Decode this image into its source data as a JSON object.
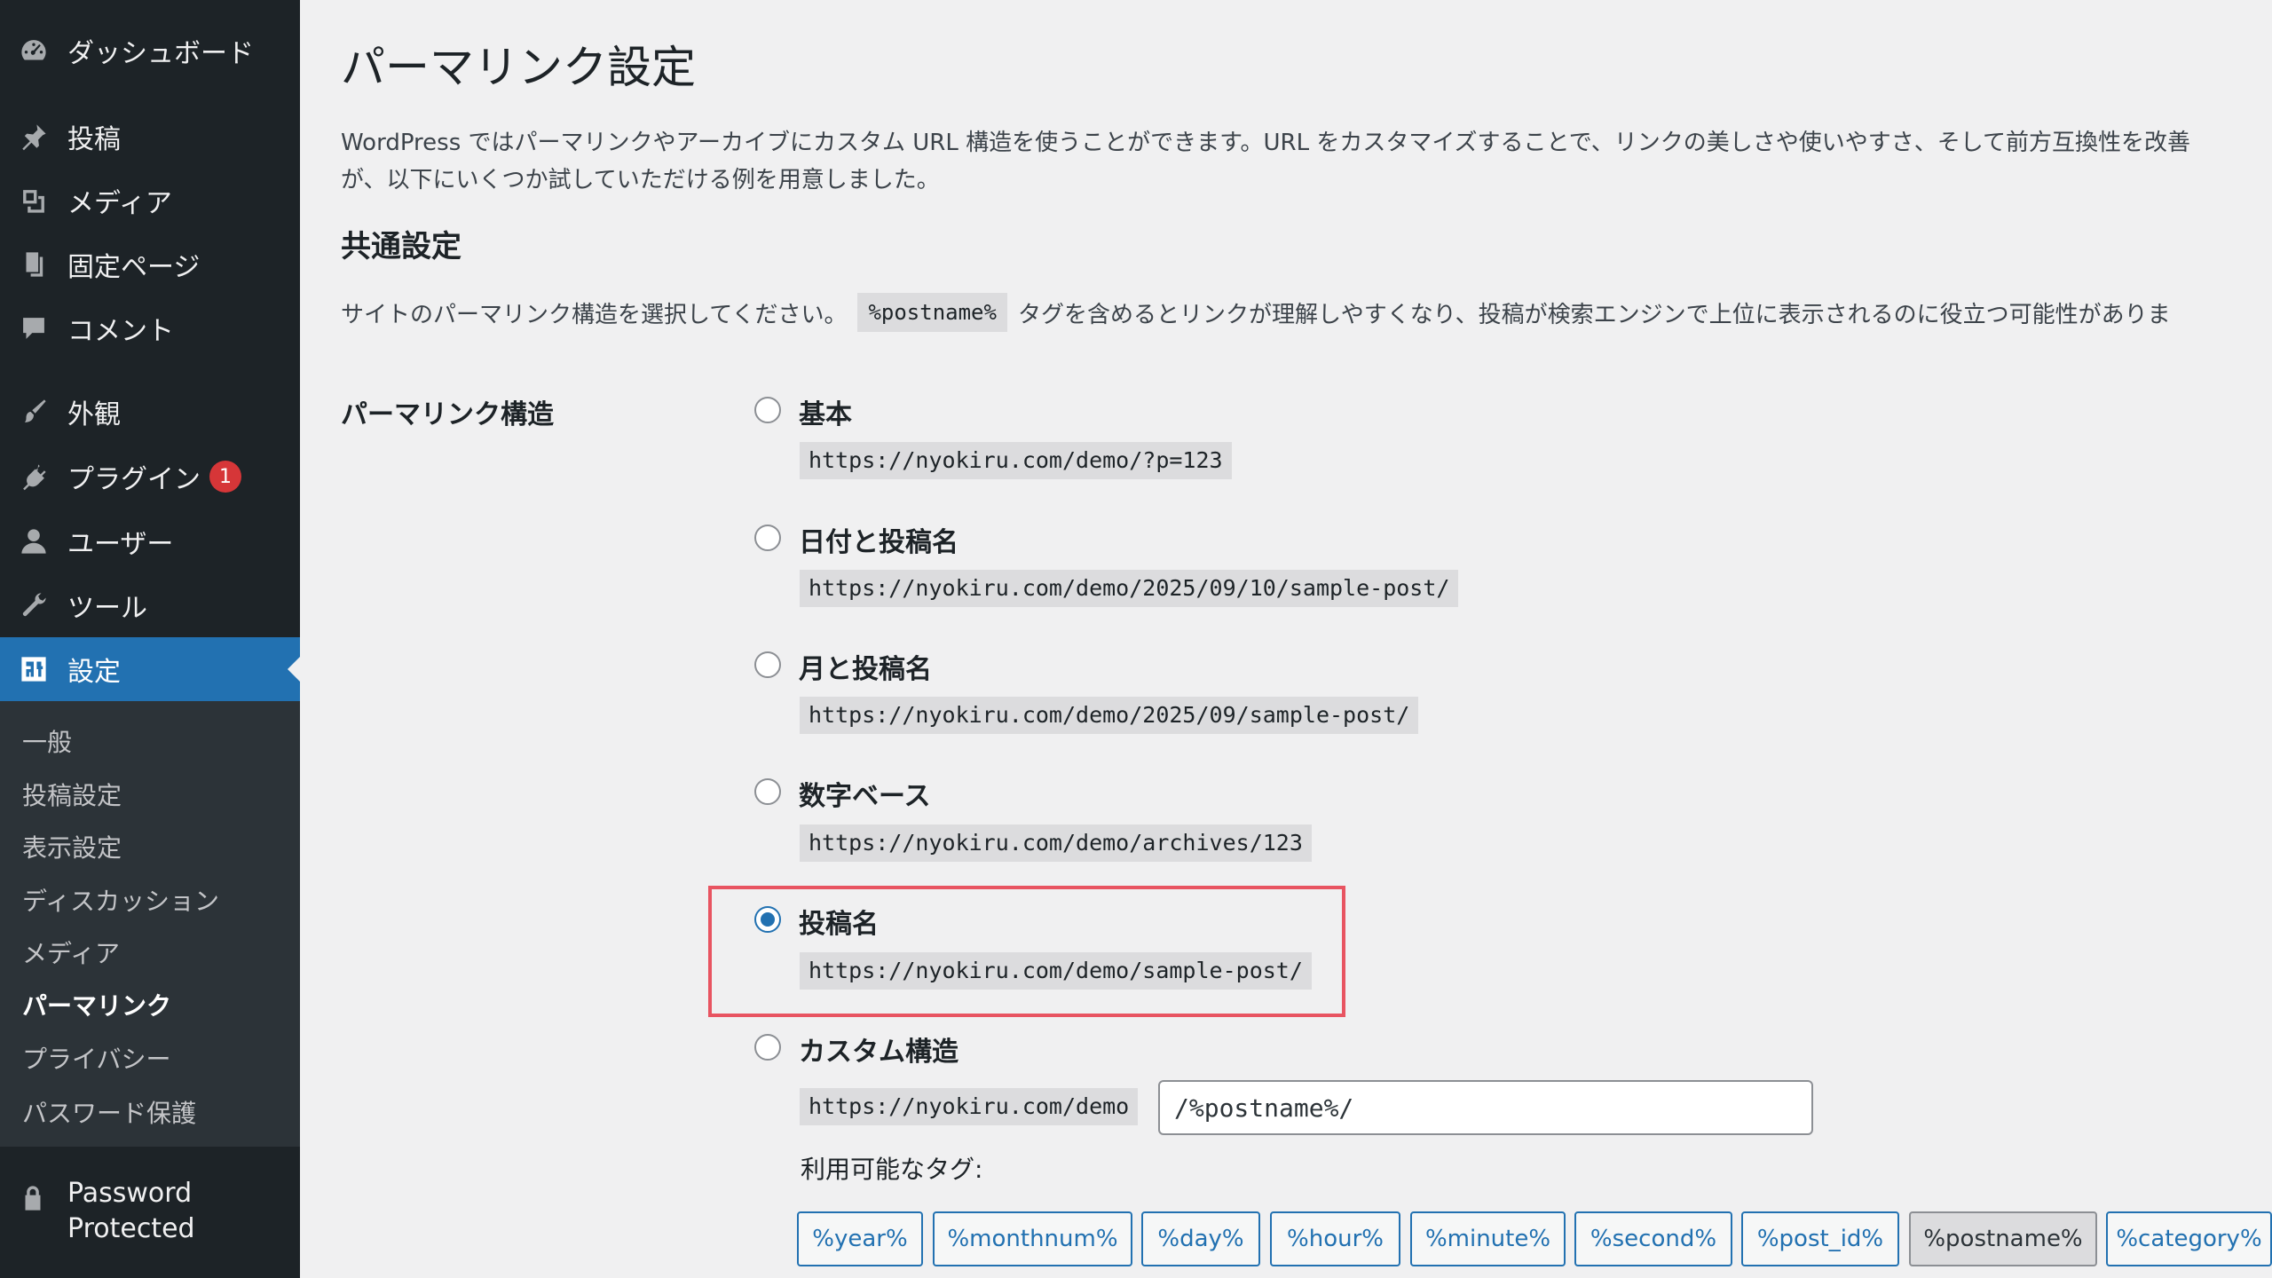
{
  "sidebar": {
    "menu": [
      {
        "label": "ダッシュボード",
        "icon": "dashboard-icon"
      },
      {
        "label": "投稿",
        "icon": "pin-icon"
      },
      {
        "label": "メディア",
        "icon": "media-icon"
      },
      {
        "label": "固定ページ",
        "icon": "page-icon"
      },
      {
        "label": "コメント",
        "icon": "comment-icon"
      },
      {
        "label": "外観",
        "icon": "brush-icon"
      },
      {
        "label": "プラグイン",
        "icon": "plugin-icon",
        "badge": "1"
      },
      {
        "label": "ユーザー",
        "icon": "user-icon"
      },
      {
        "label": "ツール",
        "icon": "wrench-icon"
      },
      {
        "label": "設定",
        "icon": "settings-icon"
      }
    ],
    "submenu": [
      "一般",
      "投稿設定",
      "表示設定",
      "ディスカッション",
      "メディア",
      "パーマリンク",
      "プライバシー",
      "パスワード保護"
    ],
    "password_protected": {
      "line1": "Password",
      "line2": "Protected",
      "icon": "lock-icon"
    }
  },
  "main": {
    "title": "パーマリンク設定",
    "intro_line1": "WordPress ではパーマリンクやアーカイブにカスタム URL 構造を使うことができます。URL をカスタマイズすることで、リンクの美しさや使いやすさ、そして前方互換性を改善",
    "intro_line2": "が、以下にいくつか試していただける例を用意しました。",
    "common_heading": "共通設定",
    "common_desc_before": "サイトのパーマリンク構造を選択してください。",
    "common_desc_code": "%postname%",
    "common_desc_after": "タグを含めるとリンクが理解しやすくなり、投稿が検索エンジンで上位に表示されるのに役立つ可能性がありま",
    "structure_label": "パーマリンク構造",
    "options": [
      {
        "label": "基本",
        "example": "https://nyokiru.com/demo/?p=123"
      },
      {
        "label": "日付と投稿名",
        "example": "https://nyokiru.com/demo/2025/09/10/sample-post/"
      },
      {
        "label": "月と投稿名",
        "example": "https://nyokiru.com/demo/2025/09/sample-post/"
      },
      {
        "label": "数字ベース",
        "example": "https://nyokiru.com/demo/archives/123"
      },
      {
        "label": "投稿名",
        "example": "https://nyokiru.com/demo/sample-post/"
      },
      {
        "label": "カスタム構造",
        "example": "https://nyokiru.com/demo"
      }
    ],
    "selected_option": "投稿名",
    "custom_value": "/%postname%/",
    "tags_label": "利用可能なタグ:",
    "tags": [
      "%year%",
      "%monthnum%",
      "%day%",
      "%hour%",
      "%minute%",
      "%second%",
      "%post_id%",
      "%postname%",
      "%category%"
    ],
    "active_tag": "%postname%"
  },
  "colors": {
    "accent": "#2271b1",
    "sidebar": "#1d2327",
    "highlight": "#e85461",
    "badge": "#d63638"
  }
}
